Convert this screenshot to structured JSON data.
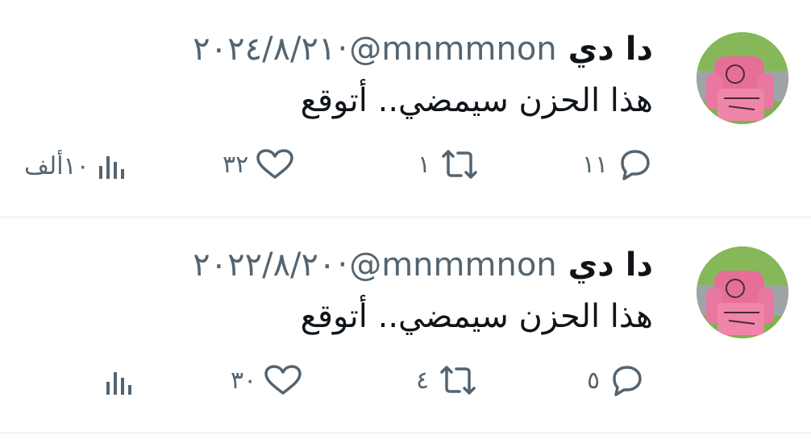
{
  "tweets": [
    {
      "name": "دا دي",
      "handle": "@mnmmnon",
      "separator": "·",
      "date": "٢٠٢٤/٨/٢١",
      "text": "هذا الحزن سيمضي.. أتوقع",
      "replies": "١١",
      "retweets": "١",
      "likes": "٣٢",
      "views": "١٠ألف"
    },
    {
      "name": "دا دي",
      "handle": "@mnmmnon",
      "separator": "·",
      "date": "٢٠٢٢/٨/٢٠",
      "text": "هذا الحزن سيمضي.. أتوقع",
      "replies": "٥",
      "retweets": "٤",
      "likes": "٣٠",
      "views": ""
    }
  ],
  "colors": {
    "text": "#0f1419",
    "secondary": "#536471",
    "divider": "#e4e7ea"
  },
  "icons": [
    "reply-icon",
    "retweet-icon",
    "like-icon",
    "views-icon"
  ]
}
